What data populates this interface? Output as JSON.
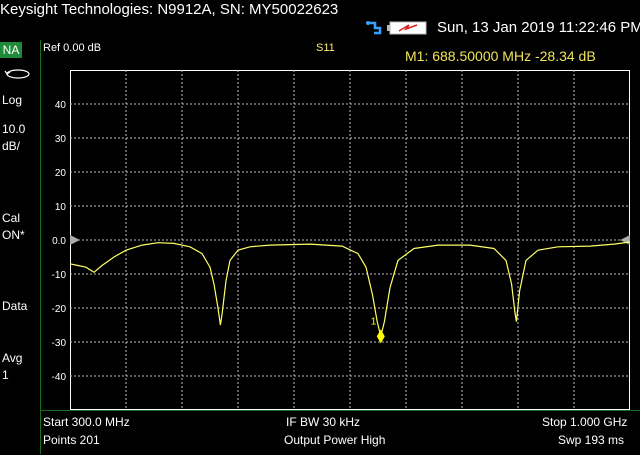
{
  "window": {
    "title": "Keysight Technologies: N9912A, SN: MY50022623"
  },
  "status": {
    "datetime": "Sun, 13 Jan 2019 11:22:46 PM",
    "icons": [
      "usb-icon",
      "battery-icon"
    ]
  },
  "left_panel": {
    "mode": "NA",
    "format": "Log",
    "scale_value": "10.0",
    "scale_unit": "dB/",
    "cal_label": "Cal",
    "cal_state": "ON*",
    "data_label": "Data",
    "avg_label": "Avg",
    "avg_value": "1"
  },
  "header": {
    "ref": "Ref 0.00 dB",
    "trace": "S11",
    "marker_readout": "M1:  688.50000 MHz  -28.34 dB"
  },
  "footer": {
    "start": "Start 300.0 MHz",
    "points": "Points 201",
    "ifbw": "IF BW 30 kHz",
    "power": "Output Power High",
    "stop": "Stop 1.000 GHz",
    "sweep": "Swp 193 ms"
  },
  "chart_data": {
    "type": "line",
    "title": "S11",
    "xlabel": "",
    "ylabel": "",
    "xlim": [
      300,
      1000
    ],
    "ylim": [
      -50,
      50
    ],
    "y_ticks": [
      40,
      30,
      20,
      10,
      0.0,
      -10,
      -20,
      -30,
      -40
    ],
    "y_tick_labels": [
      "40",
      "30",
      "20",
      "10",
      "0.0",
      "-10",
      "-20",
      "-30",
      "-40"
    ],
    "grid": true,
    "series": [
      {
        "color": "#ffff66",
        "x": [
          300,
          310,
          320,
          330,
          340,
          355,
          370,
          390,
          410,
          430,
          450,
          465,
          475,
          480,
          485,
          488,
          490,
          495,
          500,
          510,
          525,
          550,
          600,
          640,
          660,
          670,
          678,
          684,
          688.5,
          693,
          700,
          710,
          730,
          760,
          800,
          830,
          845,
          852,
          856,
          858,
          862,
          870,
          885,
          910,
          950,
          980,
          1000
        ],
        "y": [
          -7,
          -7.5,
          -8,
          -9.5,
          -7.5,
          -5,
          -3,
          -1.5,
          -0.8,
          -1,
          -2,
          -4,
          -8,
          -13,
          -20,
          -25,
          -22,
          -12,
          -6,
          -3,
          -2,
          -1.5,
          -1.2,
          -1.8,
          -4,
          -8,
          -16,
          -24,
          -28.34,
          -24,
          -14,
          -6,
          -2.5,
          -1.5,
          -1.5,
          -2.5,
          -6,
          -13,
          -21,
          -24,
          -15,
          -6,
          -3,
          -2,
          -1.8,
          -1.2,
          -0.6
        ]
      }
    ],
    "markers": [
      {
        "label": "1",
        "x": 688.5,
        "y": -28.34
      }
    ],
    "reference_level": 0.0
  }
}
